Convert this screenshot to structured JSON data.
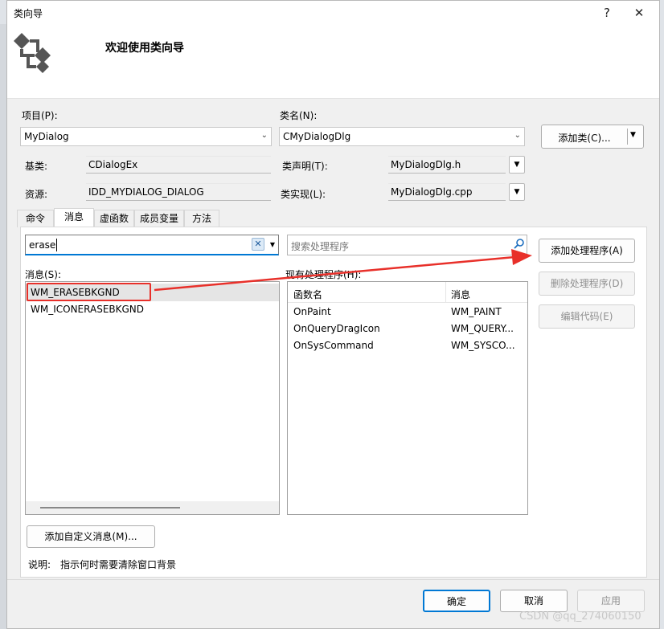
{
  "window": {
    "title": "类向导",
    "help_symbol": "?",
    "close_symbol": "✕",
    "welcome": "欢迎使用类向导"
  },
  "project": {
    "label": "项目(P):",
    "value": "MyDialog"
  },
  "classname": {
    "label": "类名(N):",
    "value": "CMyDialogDlg"
  },
  "add_class_button": "添加类(C)...",
  "base_class": {
    "label": "基类:",
    "value": "CDialogEx"
  },
  "resource": {
    "label": "资源:",
    "value": "IDD_MYDIALOG_DIALOG"
  },
  "class_decl": {
    "label": "类声明(T):",
    "value": "MyDialogDlg.h"
  },
  "class_impl": {
    "label": "类实现(L):",
    "value": "MyDialogDlg.cpp"
  },
  "tabs": [
    {
      "label": "命令"
    },
    {
      "label": "消息"
    },
    {
      "label": "虚函数"
    },
    {
      "label": "成员变量"
    },
    {
      "label": "方法"
    }
  ],
  "search_messages": {
    "value": "erase"
  },
  "search_handlers": {
    "placeholder": "搜索处理程序"
  },
  "messages": {
    "label": "消息(S):",
    "items": [
      "WM_ERASEBKGND",
      "WM_ICONERASEBKGND"
    ]
  },
  "handlers": {
    "label": "现有处理程序(H):",
    "columns": [
      "函数名",
      "消息"
    ],
    "rows": [
      [
        "OnPaint",
        "WM_PAINT"
      ],
      [
        "OnQueryDragIcon",
        "WM_QUERY..."
      ],
      [
        "OnSysCommand",
        "WM_SYSCO..."
      ]
    ]
  },
  "actions": {
    "add_handler": "添加处理程序(A)",
    "delete_handler": "删除处理程序(D)",
    "edit_code": "编辑代码(E)"
  },
  "add_custom_message": "添加自定义消息(M)...",
  "description": {
    "label": "说明:",
    "text": "指示何时需要清除窗口背景"
  },
  "footer": {
    "ok": "确定",
    "cancel": "取消",
    "apply": "应用"
  },
  "watermark": "CSDN @qq_274060150",
  "colors": {
    "annotation_red": "#e8302a",
    "accent_blue": "#0078d4"
  }
}
